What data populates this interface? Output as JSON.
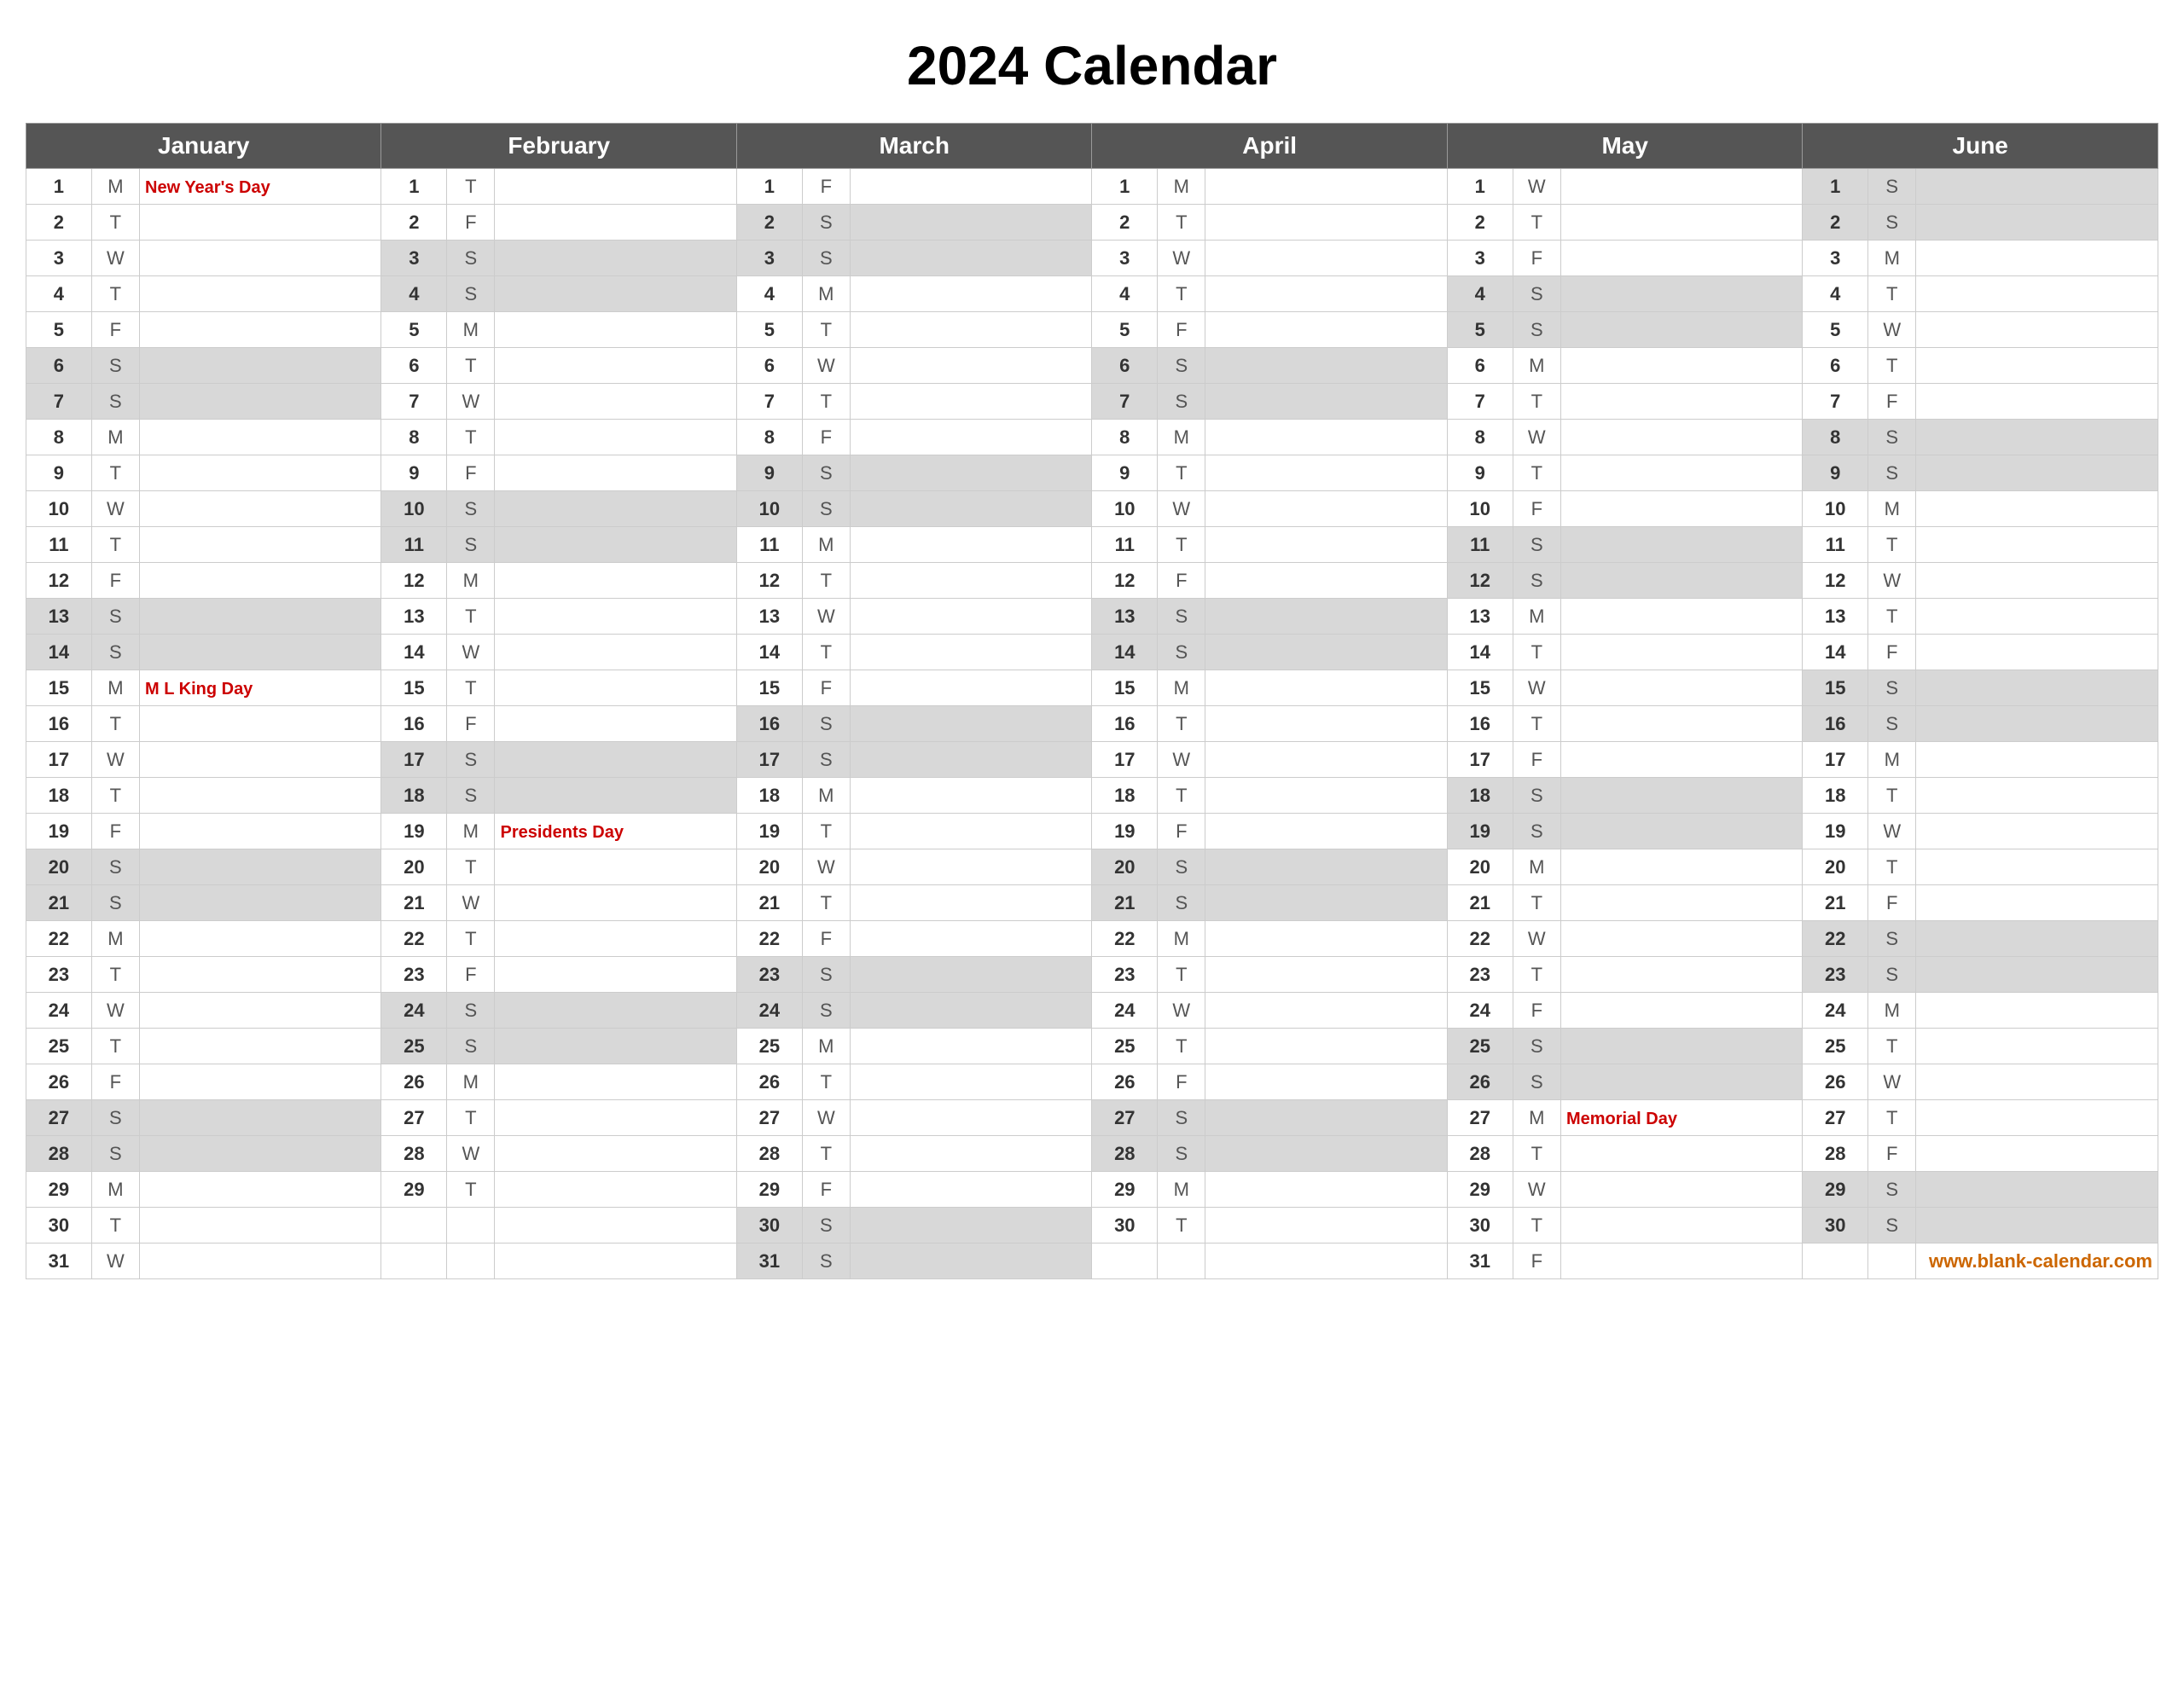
{
  "title": "2024 Calendar",
  "months": [
    "January",
    "February",
    "March",
    "April",
    "May",
    "June"
  ],
  "footer": "www.blank-calendar.com",
  "days": {
    "jan": [
      {
        "d": 1,
        "day": "M",
        "holiday": "New Year's Day"
      },
      {
        "d": 2,
        "day": "T",
        "holiday": ""
      },
      {
        "d": 3,
        "day": "W",
        "holiday": ""
      },
      {
        "d": 4,
        "day": "T",
        "holiday": ""
      },
      {
        "d": 5,
        "day": "F",
        "holiday": ""
      },
      {
        "d": 6,
        "day": "S",
        "holiday": ""
      },
      {
        "d": 7,
        "day": "S",
        "holiday": ""
      },
      {
        "d": 8,
        "day": "M",
        "holiday": ""
      },
      {
        "d": 9,
        "day": "T",
        "holiday": ""
      },
      {
        "d": 10,
        "day": "W",
        "holiday": ""
      },
      {
        "d": 11,
        "day": "T",
        "holiday": ""
      },
      {
        "d": 12,
        "day": "F",
        "holiday": ""
      },
      {
        "d": 13,
        "day": "S",
        "holiday": ""
      },
      {
        "d": 14,
        "day": "S",
        "holiday": ""
      },
      {
        "d": 15,
        "day": "M",
        "holiday": "M L King Day"
      },
      {
        "d": 16,
        "day": "T",
        "holiday": ""
      },
      {
        "d": 17,
        "day": "W",
        "holiday": ""
      },
      {
        "d": 18,
        "day": "T",
        "holiday": ""
      },
      {
        "d": 19,
        "day": "F",
        "holiday": ""
      },
      {
        "d": 20,
        "day": "S",
        "holiday": ""
      },
      {
        "d": 21,
        "day": "S",
        "holiday": ""
      },
      {
        "d": 22,
        "day": "M",
        "holiday": ""
      },
      {
        "d": 23,
        "day": "T",
        "holiday": ""
      },
      {
        "d": 24,
        "day": "W",
        "holiday": ""
      },
      {
        "d": 25,
        "day": "T",
        "holiday": ""
      },
      {
        "d": 26,
        "day": "F",
        "holiday": ""
      },
      {
        "d": 27,
        "day": "S",
        "holiday": ""
      },
      {
        "d": 28,
        "day": "S",
        "holiday": ""
      },
      {
        "d": 29,
        "day": "M",
        "holiday": ""
      },
      {
        "d": 30,
        "day": "T",
        "holiday": ""
      },
      {
        "d": 31,
        "day": "W",
        "holiday": ""
      }
    ],
    "feb": [
      {
        "d": 1,
        "day": "T",
        "holiday": ""
      },
      {
        "d": 2,
        "day": "F",
        "holiday": ""
      },
      {
        "d": 3,
        "day": "S",
        "holiday": ""
      },
      {
        "d": 4,
        "day": "S",
        "holiday": ""
      },
      {
        "d": 5,
        "day": "M",
        "holiday": ""
      },
      {
        "d": 6,
        "day": "T",
        "holiday": ""
      },
      {
        "d": 7,
        "day": "W",
        "holiday": ""
      },
      {
        "d": 8,
        "day": "T",
        "holiday": ""
      },
      {
        "d": 9,
        "day": "F",
        "holiday": ""
      },
      {
        "d": 10,
        "day": "S",
        "holiday": ""
      },
      {
        "d": 11,
        "day": "S",
        "holiday": ""
      },
      {
        "d": 12,
        "day": "M",
        "holiday": ""
      },
      {
        "d": 13,
        "day": "T",
        "holiday": ""
      },
      {
        "d": 14,
        "day": "W",
        "holiday": ""
      },
      {
        "d": 15,
        "day": "T",
        "holiday": ""
      },
      {
        "d": 16,
        "day": "F",
        "holiday": ""
      },
      {
        "d": 17,
        "day": "S",
        "holiday": ""
      },
      {
        "d": 18,
        "day": "S",
        "holiday": ""
      },
      {
        "d": 19,
        "day": "M",
        "holiday": "Presidents Day"
      },
      {
        "d": 20,
        "day": "T",
        "holiday": ""
      },
      {
        "d": 21,
        "day": "W",
        "holiday": ""
      },
      {
        "d": 22,
        "day": "T",
        "holiday": ""
      },
      {
        "d": 23,
        "day": "F",
        "holiday": ""
      },
      {
        "d": 24,
        "day": "S",
        "holiday": ""
      },
      {
        "d": 25,
        "day": "S",
        "holiday": ""
      },
      {
        "d": 26,
        "day": "M",
        "holiday": ""
      },
      {
        "d": 27,
        "day": "T",
        "holiday": ""
      },
      {
        "d": 28,
        "day": "W",
        "holiday": ""
      },
      {
        "d": 29,
        "day": "T",
        "holiday": ""
      }
    ],
    "mar": [
      {
        "d": 1,
        "day": "F",
        "holiday": ""
      },
      {
        "d": 2,
        "day": "S",
        "holiday": ""
      },
      {
        "d": 3,
        "day": "S",
        "holiday": ""
      },
      {
        "d": 4,
        "day": "M",
        "holiday": ""
      },
      {
        "d": 5,
        "day": "T",
        "holiday": ""
      },
      {
        "d": 6,
        "day": "W",
        "holiday": ""
      },
      {
        "d": 7,
        "day": "T",
        "holiday": ""
      },
      {
        "d": 8,
        "day": "F",
        "holiday": ""
      },
      {
        "d": 9,
        "day": "S",
        "holiday": ""
      },
      {
        "d": 10,
        "day": "S",
        "holiday": ""
      },
      {
        "d": 11,
        "day": "M",
        "holiday": ""
      },
      {
        "d": 12,
        "day": "T",
        "holiday": ""
      },
      {
        "d": 13,
        "day": "W",
        "holiday": ""
      },
      {
        "d": 14,
        "day": "T",
        "holiday": ""
      },
      {
        "d": 15,
        "day": "F",
        "holiday": ""
      },
      {
        "d": 16,
        "day": "S",
        "holiday": ""
      },
      {
        "d": 17,
        "day": "S",
        "holiday": ""
      },
      {
        "d": 18,
        "day": "M",
        "holiday": ""
      },
      {
        "d": 19,
        "day": "T",
        "holiday": ""
      },
      {
        "d": 20,
        "day": "W",
        "holiday": ""
      },
      {
        "d": 21,
        "day": "T",
        "holiday": ""
      },
      {
        "d": 22,
        "day": "F",
        "holiday": ""
      },
      {
        "d": 23,
        "day": "S",
        "holiday": ""
      },
      {
        "d": 24,
        "day": "S",
        "holiday": ""
      },
      {
        "d": 25,
        "day": "M",
        "holiday": ""
      },
      {
        "d": 26,
        "day": "T",
        "holiday": ""
      },
      {
        "d": 27,
        "day": "W",
        "holiday": ""
      },
      {
        "d": 28,
        "day": "T",
        "holiday": ""
      },
      {
        "d": 29,
        "day": "F",
        "holiday": ""
      },
      {
        "d": 30,
        "day": "S",
        "holiday": ""
      },
      {
        "d": 31,
        "day": "S",
        "holiday": ""
      }
    ],
    "apr": [
      {
        "d": 1,
        "day": "M",
        "holiday": ""
      },
      {
        "d": 2,
        "day": "T",
        "holiday": ""
      },
      {
        "d": 3,
        "day": "W",
        "holiday": ""
      },
      {
        "d": 4,
        "day": "T",
        "holiday": ""
      },
      {
        "d": 5,
        "day": "F",
        "holiday": ""
      },
      {
        "d": 6,
        "day": "S",
        "holiday": ""
      },
      {
        "d": 7,
        "day": "S",
        "holiday": ""
      },
      {
        "d": 8,
        "day": "M",
        "holiday": ""
      },
      {
        "d": 9,
        "day": "T",
        "holiday": ""
      },
      {
        "d": 10,
        "day": "W",
        "holiday": ""
      },
      {
        "d": 11,
        "day": "T",
        "holiday": ""
      },
      {
        "d": 12,
        "day": "F",
        "holiday": ""
      },
      {
        "d": 13,
        "day": "S",
        "holiday": ""
      },
      {
        "d": 14,
        "day": "S",
        "holiday": ""
      },
      {
        "d": 15,
        "day": "M",
        "holiday": ""
      },
      {
        "d": 16,
        "day": "T",
        "holiday": ""
      },
      {
        "d": 17,
        "day": "W",
        "holiday": ""
      },
      {
        "d": 18,
        "day": "T",
        "holiday": ""
      },
      {
        "d": 19,
        "day": "F",
        "holiday": ""
      },
      {
        "d": 20,
        "day": "S",
        "holiday": ""
      },
      {
        "d": 21,
        "day": "S",
        "holiday": ""
      },
      {
        "d": 22,
        "day": "M",
        "holiday": ""
      },
      {
        "d": 23,
        "day": "T",
        "holiday": ""
      },
      {
        "d": 24,
        "day": "W",
        "holiday": ""
      },
      {
        "d": 25,
        "day": "T",
        "holiday": ""
      },
      {
        "d": 26,
        "day": "F",
        "holiday": ""
      },
      {
        "d": 27,
        "day": "S",
        "holiday": ""
      },
      {
        "d": 28,
        "day": "S",
        "holiday": ""
      },
      {
        "d": 29,
        "day": "M",
        "holiday": ""
      },
      {
        "d": 30,
        "day": "T",
        "holiday": ""
      }
    ],
    "may": [
      {
        "d": 1,
        "day": "W",
        "holiday": ""
      },
      {
        "d": 2,
        "day": "T",
        "holiday": ""
      },
      {
        "d": 3,
        "day": "F",
        "holiday": ""
      },
      {
        "d": 4,
        "day": "S",
        "holiday": ""
      },
      {
        "d": 5,
        "day": "S",
        "holiday": ""
      },
      {
        "d": 6,
        "day": "M",
        "holiday": ""
      },
      {
        "d": 7,
        "day": "T",
        "holiday": ""
      },
      {
        "d": 8,
        "day": "W",
        "holiday": ""
      },
      {
        "d": 9,
        "day": "T",
        "holiday": ""
      },
      {
        "d": 10,
        "day": "F",
        "holiday": ""
      },
      {
        "d": 11,
        "day": "S",
        "holiday": ""
      },
      {
        "d": 12,
        "day": "S",
        "holiday": ""
      },
      {
        "d": 13,
        "day": "M",
        "holiday": ""
      },
      {
        "d": 14,
        "day": "T",
        "holiday": ""
      },
      {
        "d": 15,
        "day": "W",
        "holiday": ""
      },
      {
        "d": 16,
        "day": "T",
        "holiday": ""
      },
      {
        "d": 17,
        "day": "F",
        "holiday": ""
      },
      {
        "d": 18,
        "day": "S",
        "holiday": ""
      },
      {
        "d": 19,
        "day": "S",
        "holiday": ""
      },
      {
        "d": 20,
        "day": "M",
        "holiday": ""
      },
      {
        "d": 21,
        "day": "T",
        "holiday": ""
      },
      {
        "d": 22,
        "day": "W",
        "holiday": ""
      },
      {
        "d": 23,
        "day": "T",
        "holiday": ""
      },
      {
        "d": 24,
        "day": "F",
        "holiday": ""
      },
      {
        "d": 25,
        "day": "S",
        "holiday": ""
      },
      {
        "d": 26,
        "day": "S",
        "holiday": ""
      },
      {
        "d": 27,
        "day": "M",
        "holiday": "Memorial Day"
      },
      {
        "d": 28,
        "day": "T",
        "holiday": ""
      },
      {
        "d": 29,
        "day": "W",
        "holiday": ""
      },
      {
        "d": 30,
        "day": "T",
        "holiday": ""
      },
      {
        "d": 31,
        "day": "F",
        "holiday": ""
      }
    ],
    "jun": [
      {
        "d": 1,
        "day": "S",
        "holiday": ""
      },
      {
        "d": 2,
        "day": "S",
        "holiday": ""
      },
      {
        "d": 3,
        "day": "M",
        "holiday": ""
      },
      {
        "d": 4,
        "day": "T",
        "holiday": ""
      },
      {
        "d": 5,
        "day": "W",
        "holiday": ""
      },
      {
        "d": 6,
        "day": "T",
        "holiday": ""
      },
      {
        "d": 7,
        "day": "F",
        "holiday": ""
      },
      {
        "d": 8,
        "day": "S",
        "holiday": ""
      },
      {
        "d": 9,
        "day": "S",
        "holiday": ""
      },
      {
        "d": 10,
        "day": "M",
        "holiday": ""
      },
      {
        "d": 11,
        "day": "T",
        "holiday": ""
      },
      {
        "d": 12,
        "day": "W",
        "holiday": ""
      },
      {
        "d": 13,
        "day": "T",
        "holiday": ""
      },
      {
        "d": 14,
        "day": "F",
        "holiday": ""
      },
      {
        "d": 15,
        "day": "S",
        "holiday": ""
      },
      {
        "d": 16,
        "day": "S",
        "holiday": ""
      },
      {
        "d": 17,
        "day": "M",
        "holiday": ""
      },
      {
        "d": 18,
        "day": "T",
        "holiday": ""
      },
      {
        "d": 19,
        "day": "W",
        "holiday": ""
      },
      {
        "d": 20,
        "day": "T",
        "holiday": ""
      },
      {
        "d": 21,
        "day": "F",
        "holiday": ""
      },
      {
        "d": 22,
        "day": "S",
        "holiday": ""
      },
      {
        "d": 23,
        "day": "S",
        "holiday": ""
      },
      {
        "d": 24,
        "day": "M",
        "holiday": ""
      },
      {
        "d": 25,
        "day": "T",
        "holiday": ""
      },
      {
        "d": 26,
        "day": "W",
        "holiday": ""
      },
      {
        "d": 27,
        "day": "T",
        "holiday": ""
      },
      {
        "d": 28,
        "day": "F",
        "holiday": ""
      },
      {
        "d": 29,
        "day": "S",
        "holiday": ""
      },
      {
        "d": 30,
        "day": "S",
        "holiday": ""
      }
    ]
  }
}
